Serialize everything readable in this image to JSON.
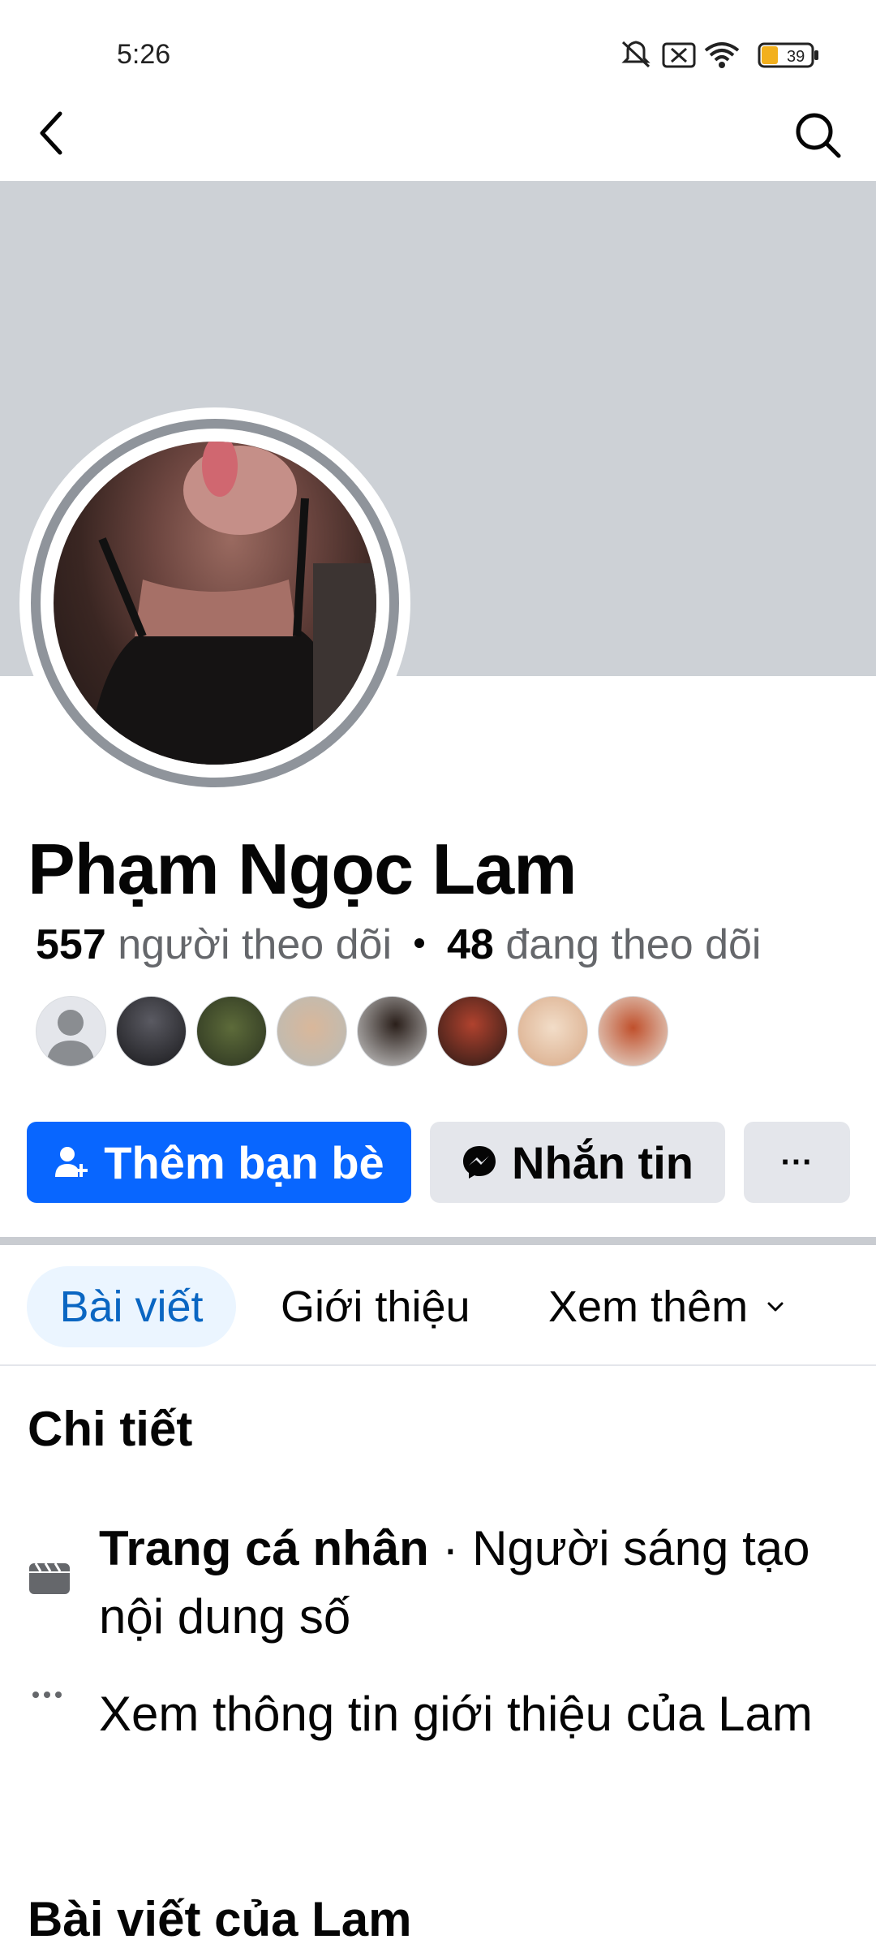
{
  "status_bar": {
    "time": "5:26",
    "battery": "39",
    "icons": [
      "mute-icon",
      "no-sim-icon",
      "wifi-icon",
      "battery-icon"
    ]
  },
  "header": {
    "back_icon": "chevron-left-icon",
    "search_icon": "search-icon"
  },
  "profile": {
    "name": "Phạm Ngọc Lam",
    "followers_count": "557",
    "followers_label": "người theo dõi",
    "following_count": "48",
    "following_label": "đang theo dõi",
    "friend_avatars_count": 8
  },
  "actions": {
    "add_friend_label": "Thêm bạn bè",
    "message_label": "Nhắn tin",
    "more_label": "···"
  },
  "tabs": [
    {
      "label": "Bài viết",
      "active": true
    },
    {
      "label": "Giới thiệu",
      "active": false
    },
    {
      "label": "Xem thêm",
      "active": false
    }
  ],
  "details": {
    "title": "Chi tiết",
    "items": [
      {
        "bold": "Trang cá nhân",
        "text": " · Người sáng tạo nội dung số",
        "icon": "clapperboard-icon"
      },
      {
        "text": "Xem thông tin giới thiệu của Lam",
        "icon": "more-dots-icon"
      }
    ]
  },
  "posts_section": {
    "title": "Bài viết của Lam"
  },
  "colors": {
    "primary": "#0866ff",
    "secondary_button": "#e4e6eb",
    "cover": "#cdd1d6",
    "active_tab_bg": "#ebf5ff",
    "active_tab_text": "#0a66c2"
  }
}
